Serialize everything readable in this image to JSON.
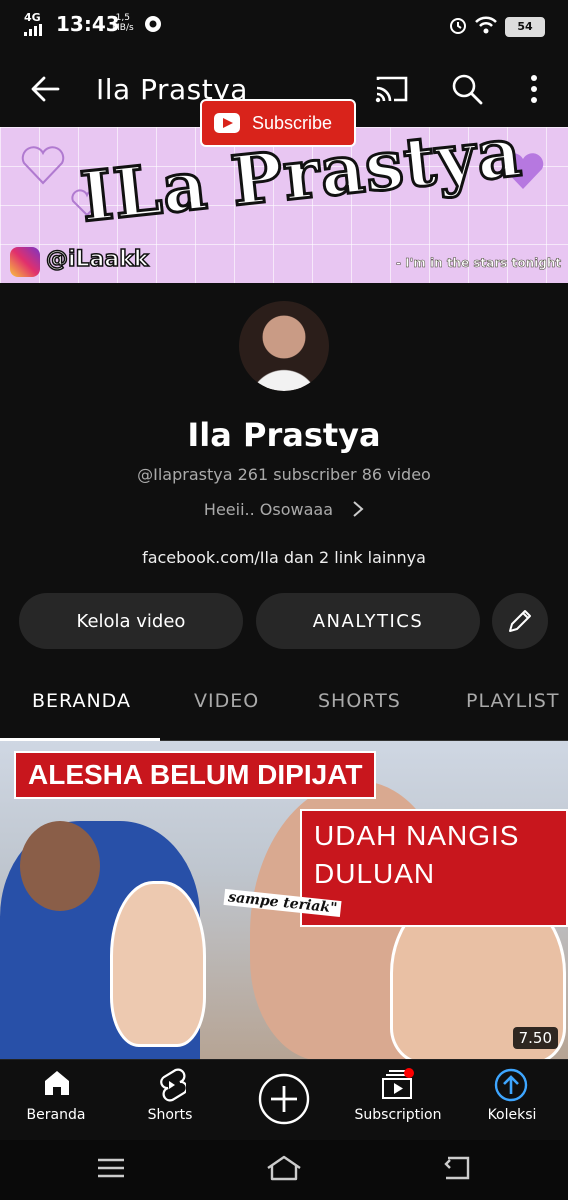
{
  "status_bar": {
    "network": "4G",
    "time": "13:43",
    "speed_value": "1,5",
    "speed_unit": "MB/s",
    "battery": "54"
  },
  "top_bar": {
    "title": "Ila Prastya",
    "icons": [
      "back-arrow-icon",
      "cast-icon",
      "search-icon",
      "more-vert-icon"
    ]
  },
  "banner": {
    "name": "ILa Prastya",
    "subscribe": "Subscribe",
    "instagram": "@iLaakk",
    "tagline": "- I'm in the stars tonight"
  },
  "channel": {
    "name": "Ila Prastya",
    "meta": "@Ilaprastya  261 subscriber  86 video",
    "description": "Heeii.. Osowaaa",
    "links": "facebook.com/Ila dan 2 link lainnya"
  },
  "actions": {
    "manage": "Kelola video",
    "analytics": "ANALYTICS"
  },
  "tabs": [
    {
      "label": "BERANDA",
      "active": true
    },
    {
      "label": "VIDEO"
    },
    {
      "label": "SHORTS"
    },
    {
      "label": "PLAYLIST"
    }
  ],
  "video": {
    "title_line1": "ALESHA BELUM DIPIJAT",
    "title_line2a": "UDAH NANGIS",
    "title_line2b": "DULUAN",
    "caption": "sampe teriak\"",
    "duration": "7.50"
  },
  "bottom_nav": [
    {
      "label": "Beranda",
      "icon": "home-icon"
    },
    {
      "label": "Shorts",
      "icon": "shorts-icon"
    },
    {
      "label": "",
      "icon": "create-plus-icon"
    },
    {
      "label": "Subscription",
      "icon": "subscriptions-icon"
    },
    {
      "label": "Koleksi",
      "icon": "library-icon"
    }
  ],
  "colors": {
    "background": "#0f0f0f",
    "button_bg": "#272727",
    "youtube_red": "#d9231b",
    "koleksi_blue": "#3ea6ff"
  }
}
